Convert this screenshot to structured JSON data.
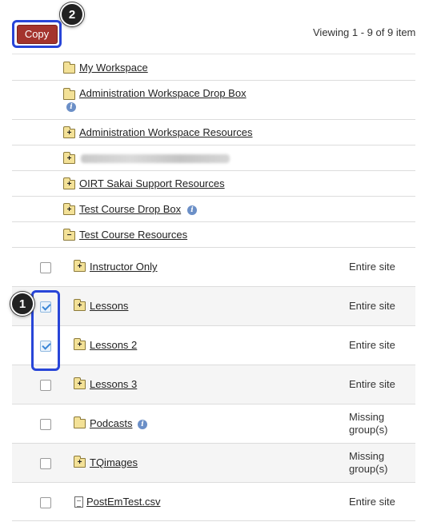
{
  "toolbar": {
    "copy_label": "Copy"
  },
  "viewing_text": "Viewing 1 - 9 of 9 item",
  "callouts": {
    "one": "1",
    "two": "2"
  },
  "top_rows": [
    {
      "label": "My Workspace",
      "icon": "folder-icon"
    },
    {
      "label": "Administration Workspace Drop Box",
      "icon": "folder-icon",
      "info": "i"
    },
    {
      "label": "Administration Workspace Resources",
      "icon": "folder-plus-icon"
    },
    {
      "label": "",
      "icon": "folder-plus-icon",
      "redacted": true
    },
    {
      "label": "OIRT Sakai Support Resources",
      "icon": "folder-plus-icon"
    },
    {
      "label": "Test Course Drop Box",
      "icon": "folder-plus-icon",
      "info": "i"
    },
    {
      "label": "Test Course Resources",
      "icon": "folder-open-icon"
    }
  ],
  "items": [
    {
      "label": "Instructor Only",
      "icon": "folder-plus-icon",
      "checked": false,
      "access": "Entire site"
    },
    {
      "label": "Lessons",
      "icon": "folder-plus-icon",
      "checked": true,
      "access": "Entire site"
    },
    {
      "label": "Lessons 2",
      "icon": "folder-plus-icon",
      "checked": true,
      "access": "Entire site"
    },
    {
      "label": "Lessons 3",
      "icon": "folder-plus-icon",
      "checked": false,
      "access": "Entire site"
    },
    {
      "label": "Podcasts",
      "icon": "folder-icon",
      "checked": false,
      "info": "i",
      "access_line1": "Missing",
      "access_line2": "group(s)"
    },
    {
      "label": "TQimages",
      "icon": "folder-plus-icon",
      "checked": false,
      "access_line1": "Missing",
      "access_line2": "group(s)"
    },
    {
      "label": "PostEmTest.csv",
      "icon": "file-icon",
      "checked": false,
      "access": "Entire site"
    }
  ],
  "colors": {
    "copy_button": "#a4332d",
    "highlight": "#2845d8",
    "info_icon": "#6b8fc7",
    "folder": "#f3e197"
  }
}
